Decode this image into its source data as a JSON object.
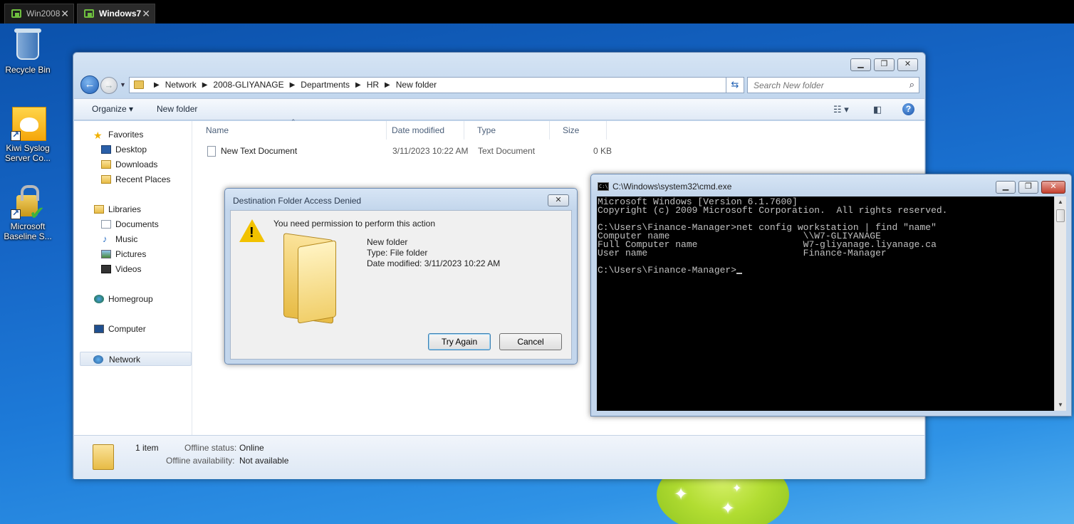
{
  "host_tabs": [
    {
      "label": "Win2008"
    },
    {
      "label": "Windows7"
    }
  ],
  "desktop_icons": [
    {
      "label": "Recycle Bin",
      "icon": "recycle-bin-icon"
    },
    {
      "label": "Kiwi Syslog Server Co...",
      "icon": "kiwi-syslog-icon"
    },
    {
      "label": "Microsoft Baseline S...",
      "icon": "baseline-security-icon"
    }
  ],
  "explorer": {
    "breadcrumb": [
      "Network",
      "2008-GLIYANAGE",
      "Departments",
      "HR",
      "New folder"
    ],
    "search_placeholder": "Search New folder",
    "toolbar": {
      "organize": "Organize ▾",
      "new_folder": "New folder"
    },
    "nav": {
      "favorites": "Favorites",
      "desktop": "Desktop",
      "downloads": "Downloads",
      "recent": "Recent Places",
      "libraries": "Libraries",
      "documents": "Documents",
      "music": "Music",
      "pictures": "Pictures",
      "videos": "Videos",
      "homegroup": "Homegroup",
      "computer": "Computer",
      "network": "Network"
    },
    "columns": {
      "name": "Name",
      "date": "Date modified",
      "type": "Type",
      "size": "Size"
    },
    "files": [
      {
        "name": "New Text Document",
        "date": "3/11/2023 10:22 AM",
        "type": "Text Document",
        "size": "0 KB"
      }
    ],
    "status": {
      "count": "1 item",
      "offline_status_label": "Offline status:",
      "offline_status_value": "Online",
      "offline_avail_label": "Offline availability:",
      "offline_avail_value": "Not available"
    }
  },
  "dialog": {
    "title": "Destination Folder Access Denied",
    "message": "You need permission to perform this action",
    "item_name": "New folder",
    "item_type": "Type: File folder",
    "item_date": "Date modified: 3/11/2023 10:22 AM",
    "try_again": "Try Again",
    "cancel": "Cancel"
  },
  "cmd": {
    "title": "C:\\Windows\\system32\\cmd.exe",
    "icon_text": "C:\\",
    "output": "Microsoft Windows [Version 6.1.7600]\nCopyright (c) 2009 Microsoft Corporation.  All rights reserved.\n\nC:\\Users\\Finance-Manager>net config workstation | find \"name\"\nComputer name                        \\\\W7-GLIYANAGE\nFull Computer name                   W7-gliyanage.liyanage.ca\nUser name                            Finance-Manager\n\n",
    "prompt": "C:\\Users\\Finance-Manager>"
  }
}
